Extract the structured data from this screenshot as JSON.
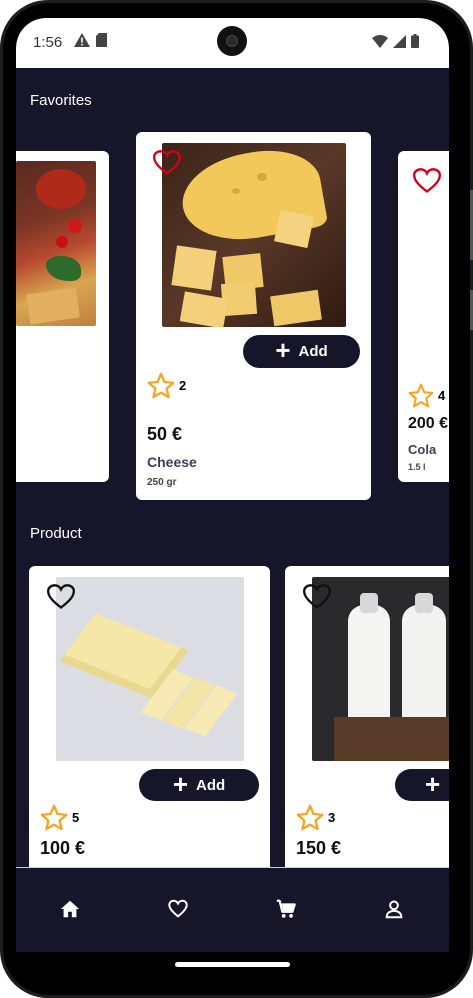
{
  "status_bar": {
    "time": "1:56"
  },
  "favorites": {
    "title": "Favorites",
    "items": [
      {
        "name": "",
        "price": "",
        "qty": "",
        "rating": ""
      },
      {
        "name": "Cheese",
        "price": "50 €",
        "qty": "250 gr",
        "rating": "2",
        "add_label": "Add"
      },
      {
        "name": "Cola",
        "price": "200 €",
        "qty": "1.5 l",
        "rating": "4"
      }
    ]
  },
  "products": {
    "title": "Product",
    "items": [
      {
        "price": "100 €",
        "rating": "5",
        "add_label": "Add"
      },
      {
        "price": "150 €",
        "rating": "3",
        "add_label": "Add"
      }
    ]
  },
  "nav": {
    "items": [
      {
        "icon": "home-icon"
      },
      {
        "icon": "heart-icon"
      },
      {
        "icon": "cart-icon"
      },
      {
        "icon": "user-icon"
      }
    ]
  },
  "colors": {
    "background": "#16162a",
    "card": "#ffffff",
    "star": "#f5a623",
    "heart_active": "#d0021b"
  }
}
